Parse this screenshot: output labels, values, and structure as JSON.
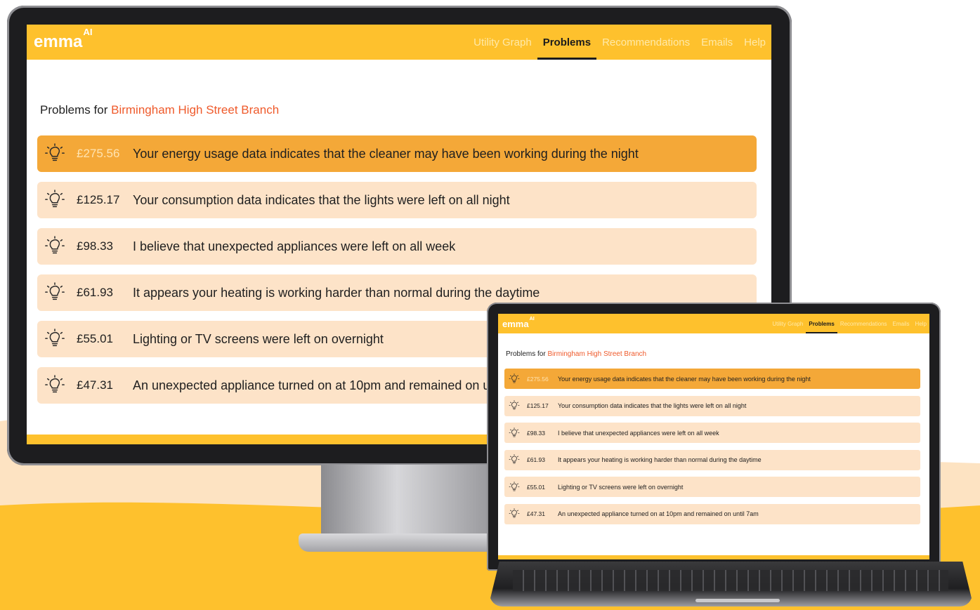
{
  "brand": {
    "logo": "emma",
    "logo_sup": "AI",
    "accent": "#fec12d",
    "highlight": "#f4a838",
    "row_bg": "#fde3c8",
    "place_color": "#ef5a2b"
  },
  "nav": [
    {
      "label": "Utility Graph",
      "active": false
    },
    {
      "label": "Problems",
      "active": true
    },
    {
      "label": "Recommendations",
      "active": false
    },
    {
      "label": "Emails",
      "active": false
    },
    {
      "label": "Help",
      "active": false
    }
  ],
  "page": {
    "title_prefix": "Problems for",
    "location": "Birmingham High Street Branch"
  },
  "problems": [
    {
      "icon": "lightbulb-icon",
      "amount": "£275.56",
      "text": "Your energy usage data indicates that the cleaner may have been working during the night",
      "highlighted": true
    },
    {
      "icon": "lightbulb-icon",
      "amount": "£125.17",
      "text": "Your consumption data indicates that the lights were left on all night",
      "highlighted": false
    },
    {
      "icon": "lightbulb-icon",
      "amount": "£98.33",
      "text": "I believe that unexpected appliances were left on all week",
      "highlighted": false
    },
    {
      "icon": "lightbulb-icon",
      "amount": "£61.93",
      "text": "It appears your heating is working harder than normal during the daytime",
      "highlighted": false
    },
    {
      "icon": "lightbulb-icon",
      "amount": "£55.01",
      "text": "Lighting or TV screens were left on overnight",
      "highlighted": false
    },
    {
      "icon": "lightbulb-icon",
      "amount": "£47.31",
      "text": "An unexpected appliance turned on at 10pm and remained on until 7am",
      "highlighted": false
    }
  ]
}
